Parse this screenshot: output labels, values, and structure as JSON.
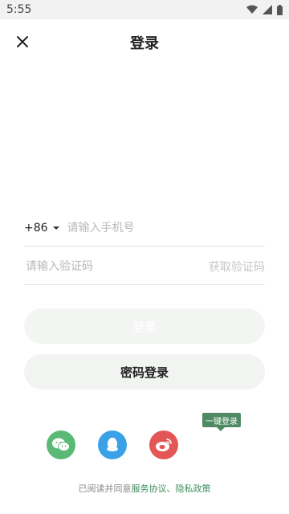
{
  "status": {
    "time": "5:55"
  },
  "header": {
    "title": "登录"
  },
  "phone": {
    "country_code": "+86",
    "placeholder": "请输入手机号"
  },
  "verification": {
    "placeholder": "请输入验证码",
    "get_code_label": "获取验证码"
  },
  "buttons": {
    "login_label": "登录",
    "password_login_label": "密码登录"
  },
  "tooltip": {
    "text": "一键登录"
  },
  "social": {
    "icons": [
      "wechat-icon",
      "qq-icon",
      "weibo-icon"
    ]
  },
  "agreement": {
    "prefix": "已阅读并同意",
    "service": "服务协议",
    "sep": "、",
    "privacy": "隐私政策"
  },
  "colors": {
    "accent": "#4f8a63",
    "wechat": "#5bb976",
    "qq": "#3aa1e7",
    "weibo": "#e25655"
  }
}
